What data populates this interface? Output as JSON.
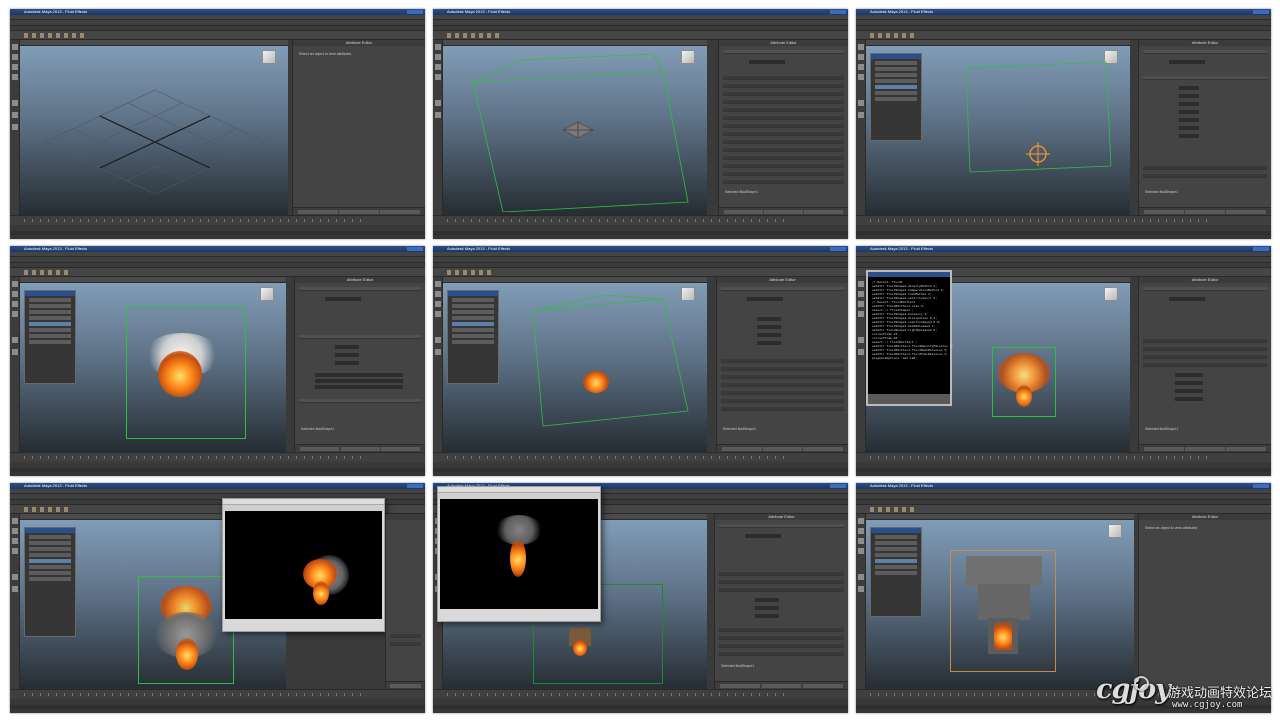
{
  "app": {
    "window_title": "Autodesk Maya 2013 - Fluid Effects",
    "attribute_editor_title": "Attribute Editor",
    "attribute_editor_empty": "Select an object to view attributes",
    "selected_node": "Selected fluidShape1"
  },
  "tiles": [
    {
      "id": 1,
      "stage": "Empty scene with ground grid"
    },
    {
      "id": 2,
      "stage": "3D fluid container created"
    },
    {
      "id": 3,
      "stage": "Emitter added, outliner open"
    },
    {
      "id": 4,
      "stage": "Smoke and fire density preview"
    },
    {
      "id": 5,
      "stage": "Fire shading attributes"
    },
    {
      "id": 6,
      "stage": "Script editor output"
    },
    {
      "id": 7,
      "stage": "Render view: fire with smoke"
    },
    {
      "id": 8,
      "stage": "Render view: rising flame"
    },
    {
      "id": 9,
      "stage": "Cached fluid playback"
    }
  ],
  "watermark": {
    "logo": "cgjoy",
    "tagline": "游戏动画特效论坛",
    "url": "www.cgjoy.com"
  },
  "colors": {
    "maya_panel": "#3a3a3a",
    "viewport_top": "#84a0bb",
    "viewport_bottom": "#262d33",
    "fluid_container": "#2fbf3f",
    "fire": "#ff8a1c",
    "title_bar": "#2b4f8a"
  }
}
